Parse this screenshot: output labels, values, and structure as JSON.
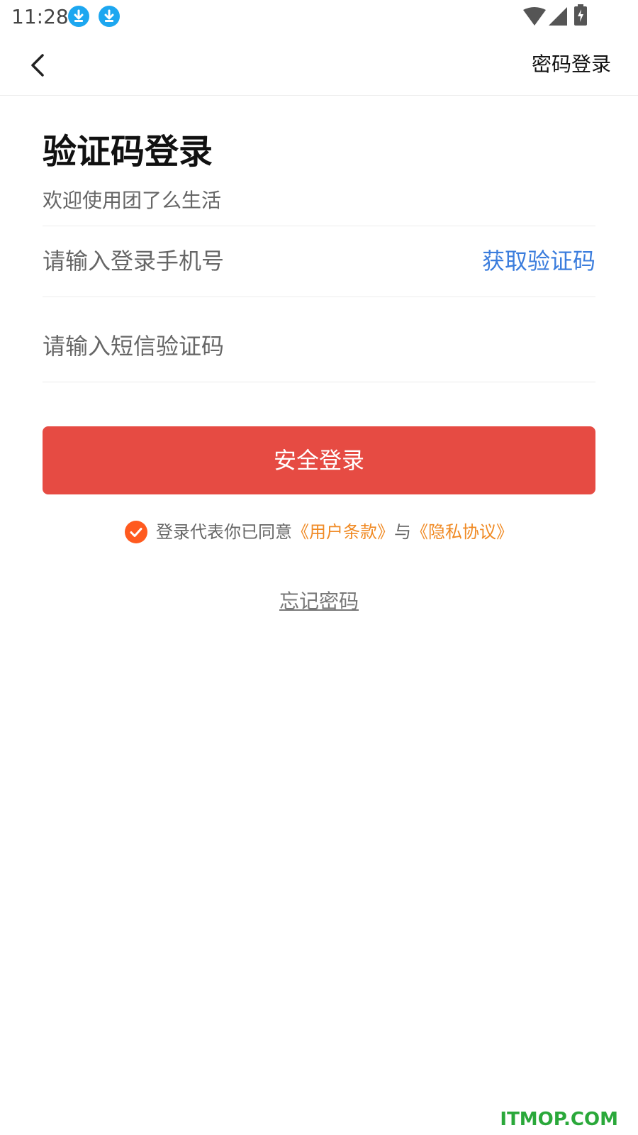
{
  "status_bar": {
    "time": "11:28",
    "icons": [
      "download-icon",
      "download-icon",
      "wifi-icon",
      "cellular-signal-icon",
      "battery-charging-icon"
    ]
  },
  "header": {
    "back_icon": "chevron-left-icon",
    "password_login_label": "密码登录"
  },
  "main": {
    "title": "验证码登录",
    "subtitle": "欢迎使用团了么生活",
    "phone_placeholder": "请输入登录手机号",
    "get_code_label": "获取验证码",
    "code_placeholder": "请输入短信验证码",
    "login_button_label": "安全登录",
    "agreement": {
      "checked": true,
      "prefix": "登录代表你已同意",
      "user_terms": "《用户条款》",
      "conjunction": "与",
      "privacy_policy": "《隐私协议》"
    },
    "forgot_password_label": "忘记密码"
  },
  "watermark": "ITMOP.COM",
  "colors": {
    "accent_red": "#e64b43",
    "link_blue": "#3b7ddd",
    "link_orange": "#f08a24",
    "check_orange": "#ff5a1f",
    "download_blue": "#1da7f0"
  }
}
